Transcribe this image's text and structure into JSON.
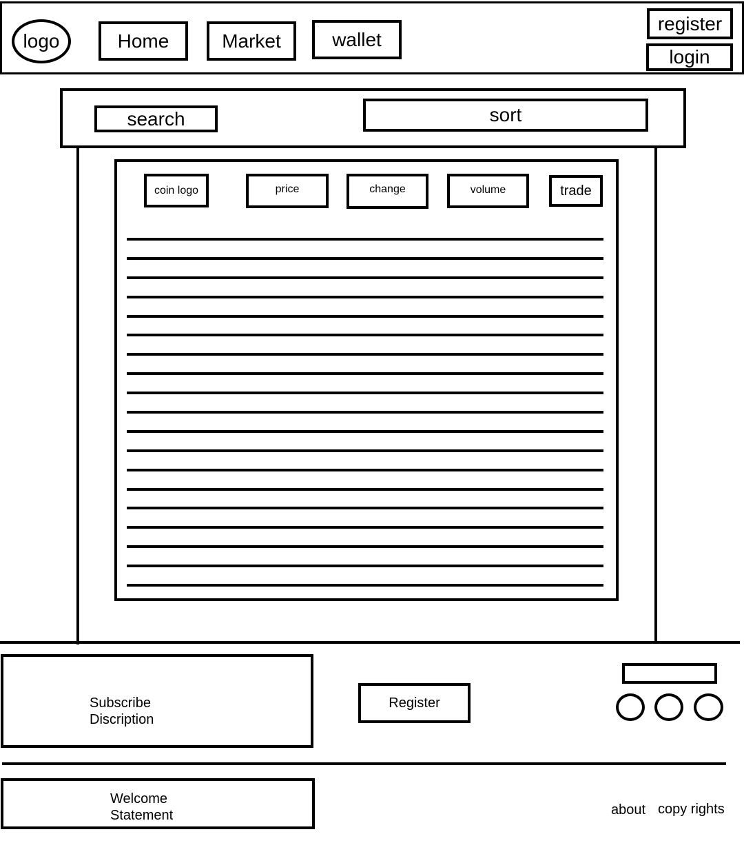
{
  "header": {
    "logo": "logo",
    "nav": [
      "Home",
      "Market",
      "wallet"
    ],
    "register": "register",
    "login": "login"
  },
  "toolbar": {
    "search": "search",
    "sort": "sort"
  },
  "table": {
    "columns": [
      "coin logo",
      "price",
      "change",
      "volume",
      "trade"
    ],
    "row_count": 19
  },
  "subscribe": {
    "description_line1": "Subscribe",
    "description_line2": "Discription",
    "register_button": "Register",
    "social_icons": [
      "circle-icon",
      "circle-icon",
      "circle-icon"
    ]
  },
  "footer": {
    "welcome_line1": "Welcome",
    "welcome_line2": "Statement",
    "about": "about",
    "copyright": "copy rights"
  }
}
